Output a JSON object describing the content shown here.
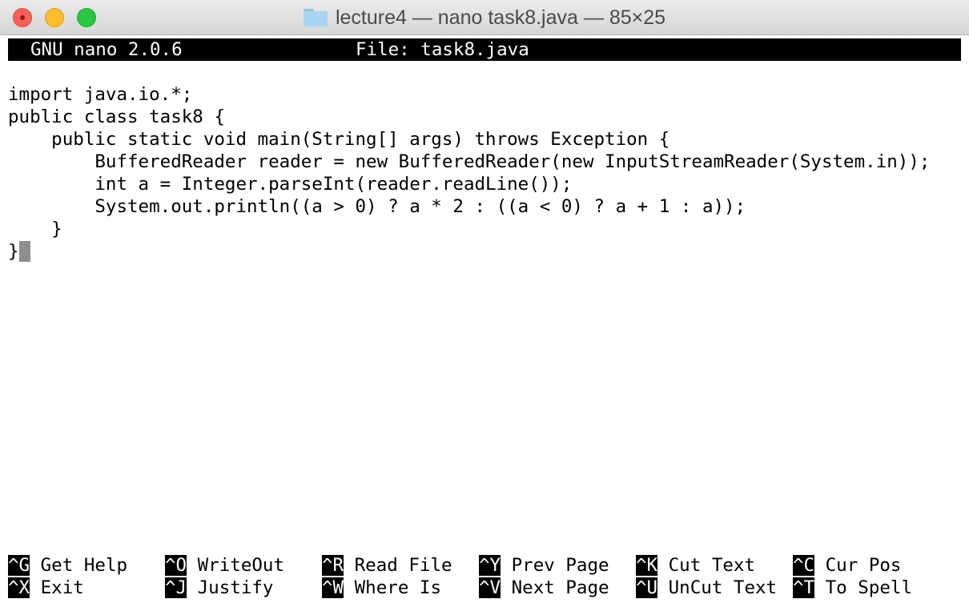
{
  "window": {
    "title": "lecture4 — nano task8.java — 85×25",
    "folder_icon": "folder-icon"
  },
  "nano": {
    "version": "GNU nano 2.0.6",
    "file_label": "File: task8.java"
  },
  "code_lines": [
    "",
    "import java.io.*;",
    "public class task8 {",
    "    public static void main(String[] args) throws Exception {",
    "        BufferedReader reader = new BufferedReader(new InputStreamReader(System.in));",
    "        int a = Integer.parseInt(reader.readLine());",
    "        System.out.println((a > 0) ? a * 2 : ((a < 0) ? a + 1 : a));",
    "    }",
    "}"
  ],
  "shortcuts": {
    "row1": [
      {
        "key": "^G",
        "label": "Get Help"
      },
      {
        "key": "^O",
        "label": "WriteOut"
      },
      {
        "key": "^R",
        "label": "Read File"
      },
      {
        "key": "^Y",
        "label": "Prev Page"
      },
      {
        "key": "^K",
        "label": "Cut Text"
      },
      {
        "key": "^C",
        "label": "Cur Pos"
      }
    ],
    "row2": [
      {
        "key": "^X",
        "label": "Exit"
      },
      {
        "key": "^J",
        "label": "Justify"
      },
      {
        "key": "^W",
        "label": "Where Is"
      },
      {
        "key": "^V",
        "label": "Next Page"
      },
      {
        "key": "^U",
        "label": "UnCut Text"
      },
      {
        "key": "^T",
        "label": "To Spell"
      }
    ]
  }
}
